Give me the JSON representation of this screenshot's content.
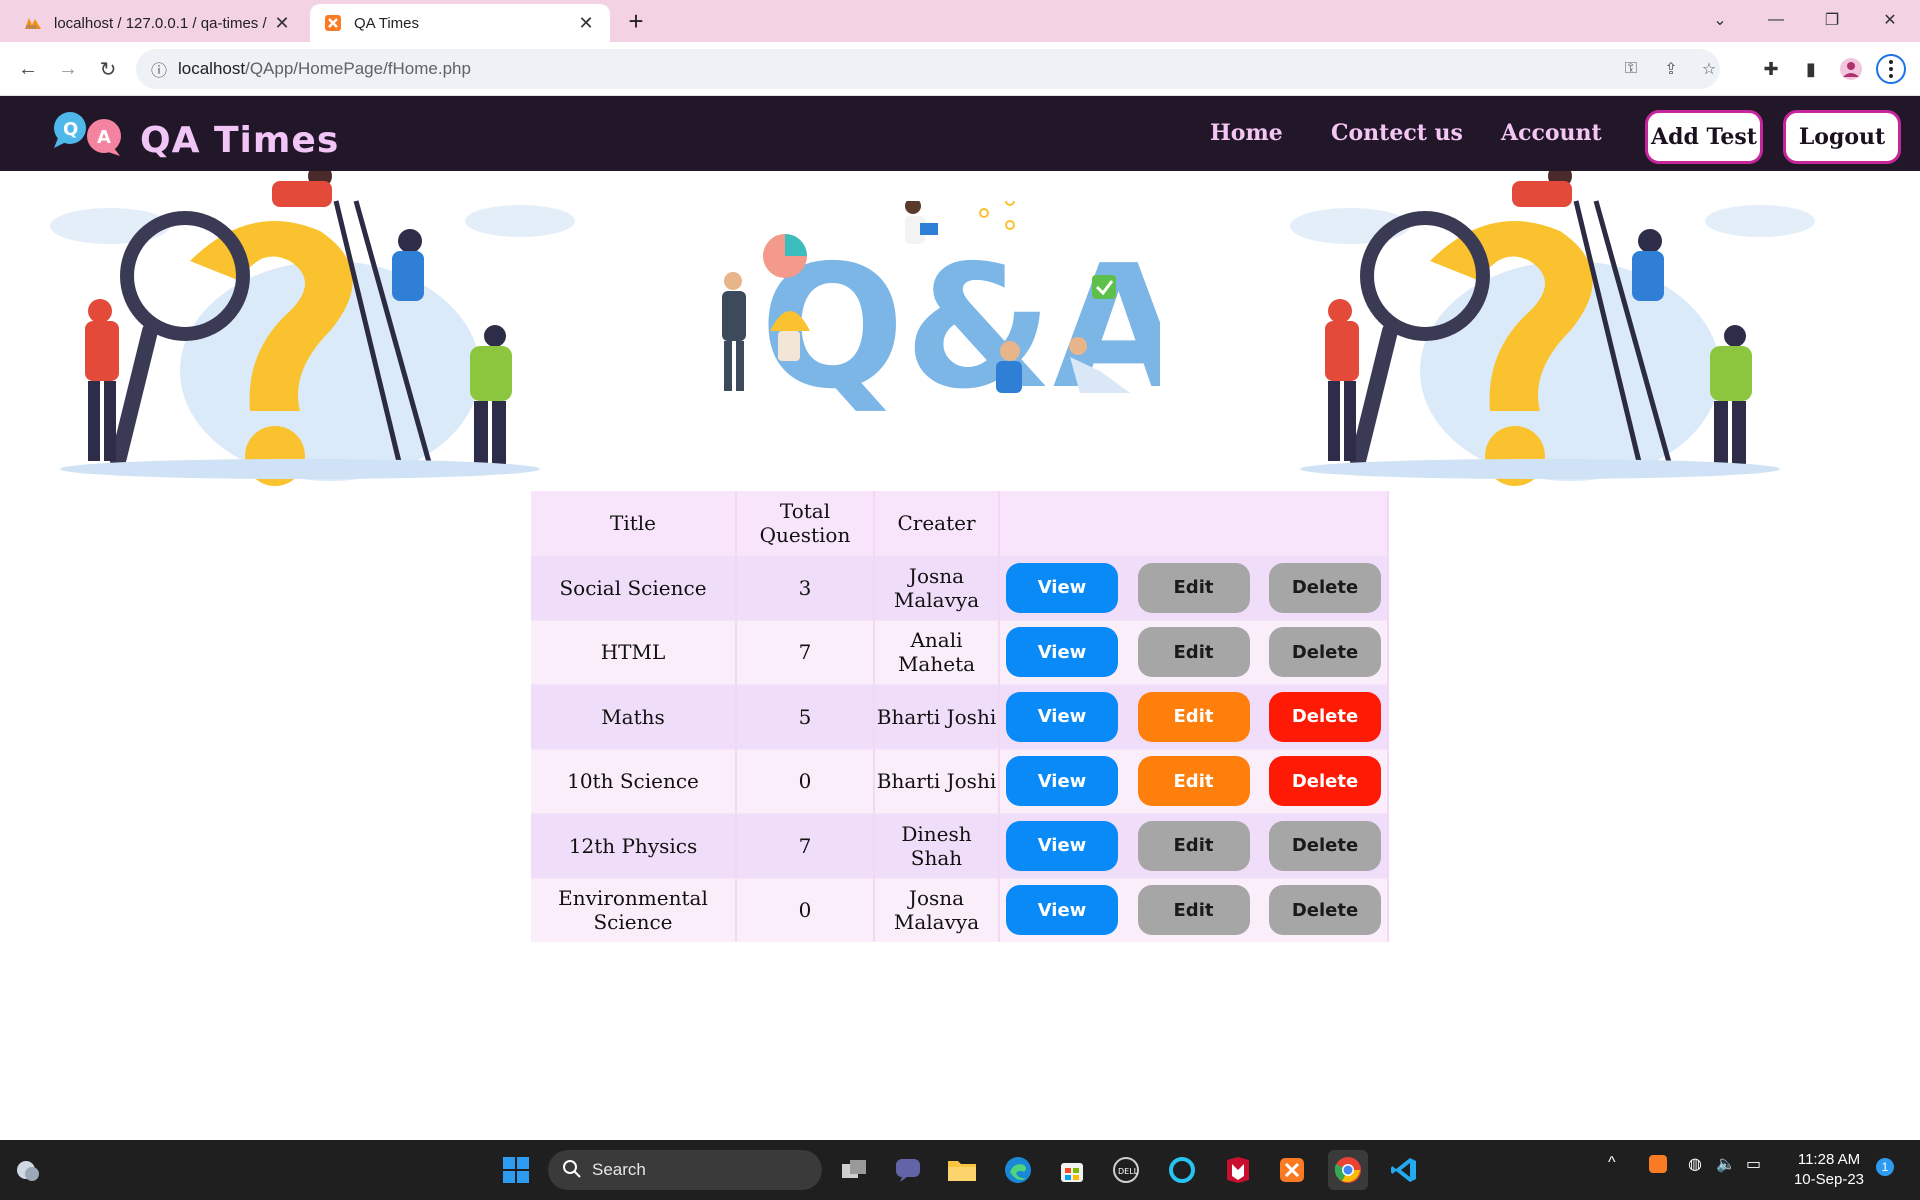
{
  "browser": {
    "tabs": [
      {
        "title": "localhost / 127.0.0.1 / qa-times /",
        "active": false,
        "icon": "phpmyadmin-icon"
      },
      {
        "title": "QA Times",
        "active": true,
        "icon": "xampp-icon"
      }
    ],
    "new_tab": "+",
    "url_host": "localhost",
    "url_path": "/QApp/HomePage/fHome.php"
  },
  "site": {
    "logo_letters": [
      "Q",
      "A"
    ],
    "title": "QA Times",
    "nav": [
      "Home",
      "Contect us",
      "Account"
    ],
    "buttons": {
      "add_test": "Add Test",
      "logout": "Logout"
    }
  },
  "banner": {
    "center_text": "Q&A"
  },
  "table": {
    "headers": [
      "Title",
      "Total Question",
      "Creater",
      ""
    ],
    "rows": [
      {
        "title": "Social Science",
        "total": "3",
        "creator": "Josna Malavya",
        "view": "View",
        "edit": "Edit",
        "delete": "Delete",
        "editable": false
      },
      {
        "title": "HTML",
        "total": "7",
        "creator": "Anali Maheta",
        "view": "View",
        "edit": "Edit",
        "delete": "Delete",
        "editable": false
      },
      {
        "title": "Maths",
        "total": "5",
        "creator": "Bharti Joshi",
        "view": "View",
        "edit": "Edit",
        "delete": "Delete",
        "editable": true
      },
      {
        "title": "10th Science",
        "total": "0",
        "creator": "Bharti Joshi",
        "view": "View",
        "edit": "Edit",
        "delete": "Delete",
        "editable": true
      },
      {
        "title": "12th Physics",
        "total": "7",
        "creator": "Dinesh Shah",
        "view": "View",
        "edit": "Edit",
        "delete": "Delete",
        "editable": false
      },
      {
        "title": "Environmental Science",
        "total": "0",
        "creator": "Josna Malavya",
        "view": "View",
        "edit": "Edit",
        "delete": "Delete",
        "editable": false
      }
    ]
  },
  "taskbar": {
    "search_label": "Search",
    "time": "11:28 AM",
    "date": "10-Sep-23",
    "notification_count": "1"
  },
  "colors": {
    "nav_bg": "#221629",
    "nav_text": "#f3c6f4",
    "view": "#0a8af6",
    "edit_active": "#ff7f0d",
    "delete_active": "#ff1a06",
    "disabled": "#a6a6a6"
  }
}
